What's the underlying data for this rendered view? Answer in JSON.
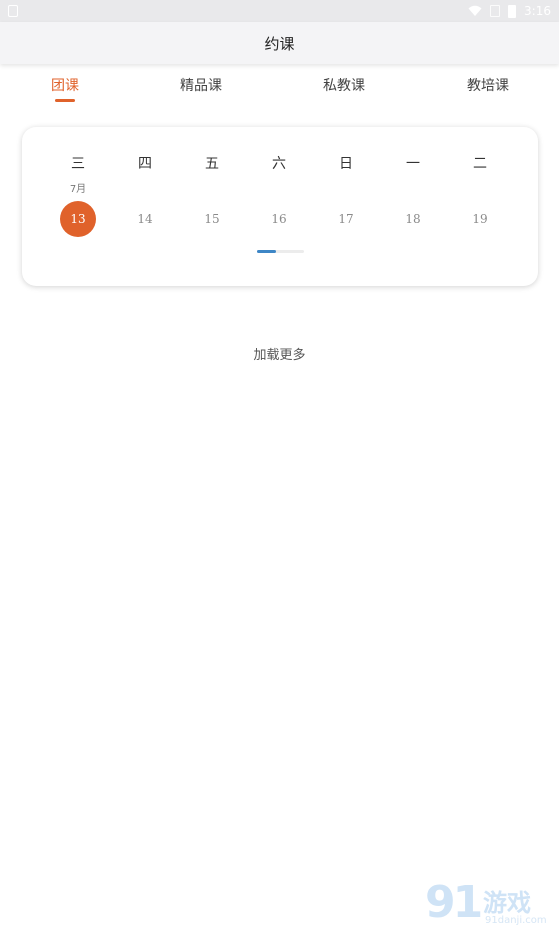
{
  "status_bar": {
    "time": "3:16"
  },
  "header": {
    "title": "约课"
  },
  "tabs": [
    {
      "label": "团课",
      "active": true
    },
    {
      "label": "精品课",
      "active": false
    },
    {
      "label": "私教课",
      "active": false
    },
    {
      "label": "教培课",
      "active": false
    }
  ],
  "calendar": {
    "weekdays": [
      "三",
      "四",
      "五",
      "六",
      "日",
      "一",
      "二"
    ],
    "month_label": "7月",
    "days": [
      "13",
      "14",
      "15",
      "16",
      "17",
      "18",
      "19"
    ],
    "selected_index": 0
  },
  "load_more": {
    "label": "加载更多"
  },
  "watermark": {
    "number": "91",
    "text": "游戏",
    "url": "91danji.com"
  },
  "colors": {
    "accent": "#e0622b",
    "scroll_thumb": "#3d86c6"
  }
}
